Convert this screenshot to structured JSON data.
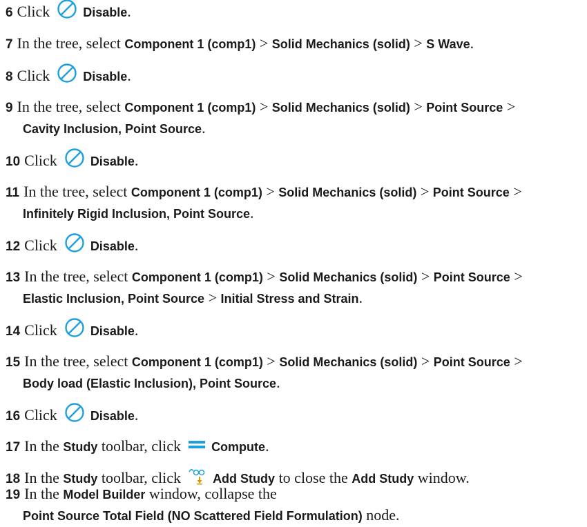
{
  "steps": [
    {
      "num": "6",
      "click": "Click",
      "action": "Disable",
      "icon": "disable-icon"
    },
    {
      "num": "7",
      "pre": "In the tree, select",
      "sep": ">",
      "path": [
        "Component 1 (comp1)",
        "Solid Mechanics (solid)",
        "S Wave"
      ]
    },
    {
      "num": "8",
      "click": "Click",
      "action": "Disable",
      "icon": "disable-icon"
    },
    {
      "num": "9",
      "pre": "In the tree, select",
      "sep": ">",
      "path": [
        "Component 1 (comp1)",
        "Solid Mechanics (solid)",
        "Point Source",
        "Cavity Inclusion, Point Source"
      ]
    },
    {
      "num": "10",
      "click": "Click",
      "action": "Disable",
      "icon": "disable-icon"
    },
    {
      "num": "11",
      "pre": "In the tree, select",
      "sep": ">",
      "path": [
        "Component 1 (comp1)",
        "Solid Mechanics (solid)",
        "Point Source",
        "Infinitely Rigid Inclusion, Point Source"
      ]
    },
    {
      "num": "12",
      "click": "Click",
      "action": "Disable",
      "icon": "disable-icon"
    },
    {
      "num": "13",
      "pre": "In the tree, select",
      "sep": ">",
      "path": [
        "Component 1 (comp1)",
        "Solid Mechanics (solid)",
        "Point Source",
        "Elastic Inclusion, Point Source",
        "Initial Stress and Strain"
      ]
    },
    {
      "num": "14",
      "click": "Click",
      "action": "Disable",
      "icon": "disable-icon"
    },
    {
      "num": "15",
      "pre": "In the tree, select",
      "sep": ">",
      "path": [
        "Component 1 (comp1)",
        "Solid Mechanics (solid)",
        "Point Source",
        "Body load (Elastic Inclusion), Point Source"
      ]
    },
    {
      "num": "16",
      "click": "Click",
      "action": "Disable",
      "icon": "disable-icon"
    },
    {
      "num": "17",
      "pre": "In the",
      "toolbar_name": "Study",
      "mid": "toolbar, click",
      "action": "Compute",
      "icon": "compute-icon"
    },
    {
      "num": "18",
      "pre": "In the",
      "toolbar_name": "Study",
      "mid": "toolbar, click",
      "action": "Add Study",
      "icon": "add-study-icon",
      "post1": "to close the",
      "window_name": "Add Study",
      "post2": "window."
    },
    {
      "num": "19",
      "pre": "In the",
      "window_name": "Model Builder",
      "mid": "window, collapse the",
      "node_name": "Point Source Total Field (NO Scattered Field Formulation)",
      "post": "node."
    }
  ],
  "period": ".",
  "colors": {
    "icon_blue": "#1e9fe0",
    "text": "#1a1a1a"
  }
}
